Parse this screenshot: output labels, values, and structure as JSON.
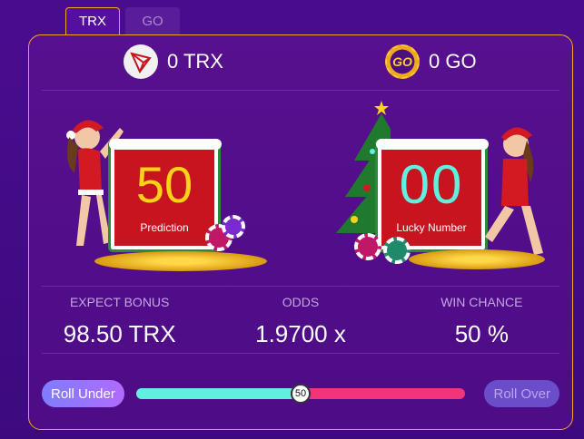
{
  "tabs": [
    {
      "label": "TRX",
      "active": true
    },
    {
      "label": "GO",
      "active": false
    }
  ],
  "balances": {
    "trx": {
      "icon": "tron-logo-icon",
      "text": "0 TRX"
    },
    "go": {
      "icon": "go-coin-icon",
      "coin_text": "GO",
      "text": "0 GO"
    }
  },
  "prediction": {
    "value": "50",
    "label": "Prediction"
  },
  "lucky": {
    "value": "00",
    "label": "Lucky Number"
  },
  "stats": [
    {
      "label": "EXPECT BONUS",
      "value": "98.50 TRX"
    },
    {
      "label": "ODDS",
      "value": "1.9700 x"
    },
    {
      "label": "WIN CHANCE",
      "value": "50 %"
    }
  ],
  "slider": {
    "roll_under_label": "Roll Under",
    "roll_over_label": "Roll Over",
    "value": 50,
    "value_text": "50",
    "min": 0,
    "max": 100
  },
  "colors": {
    "accent_border": "#f5a623",
    "track_low": "#5ff0e0",
    "track_high": "#f2357a",
    "prediction_text": "#ffd21a",
    "lucky_text": "#5ff0e0"
  }
}
